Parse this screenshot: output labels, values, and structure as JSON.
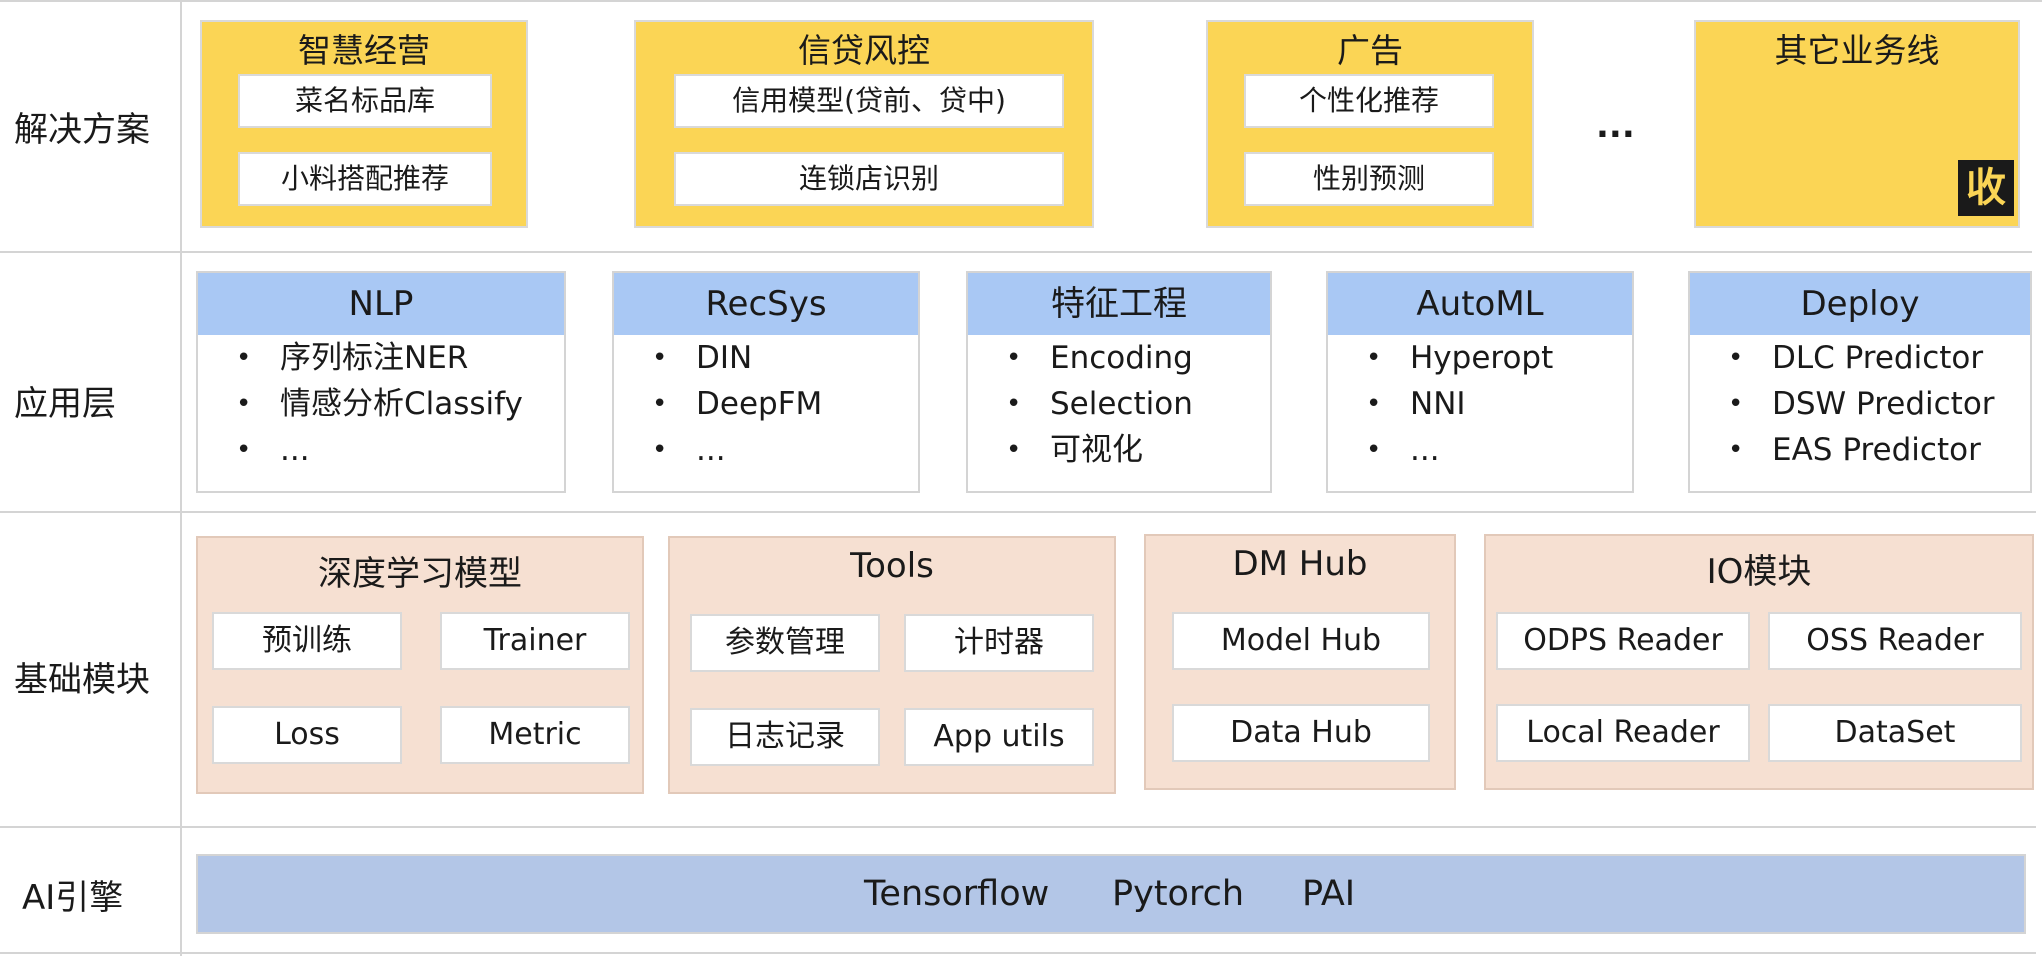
{
  "rows": {
    "solutions": "解决方案",
    "app_layer": "应用层",
    "base_modules": "基础模块",
    "ai_engine": "AI引擎"
  },
  "solutions": {
    "smart_ops": {
      "title": "智慧经营",
      "items": [
        "菜名标品库",
        "小料搭配推荐"
      ]
    },
    "credit_risk": {
      "title": "信贷风控",
      "items": [
        "信用模型(贷前、贷中)",
        "连锁店识别"
      ]
    },
    "ads": {
      "title": "广告",
      "items": [
        "个性化推荐",
        "性别预测"
      ]
    },
    "ellipsis": "...",
    "other": {
      "title": "其它业务线",
      "badge": "收"
    }
  },
  "app_layer": {
    "nlp": {
      "title": "NLP",
      "items": [
        "序列标注NER",
        "情感分析Classify",
        "..."
      ]
    },
    "recsys": {
      "title": "RecSys",
      "items": [
        "DIN",
        "DeepFM",
        "..."
      ]
    },
    "feature_eng": {
      "title": "特征工程",
      "items": [
        "Encoding",
        "Selection",
        "可视化"
      ]
    },
    "automl": {
      "title": "AutoML",
      "items": [
        "Hyperopt",
        "NNI",
        "..."
      ]
    },
    "deploy": {
      "title": "Deploy",
      "items": [
        "DLC Predictor",
        "DSW Predictor",
        "EAS Predictor"
      ]
    }
  },
  "base_modules": {
    "dl_models": {
      "title": "深度学习模型",
      "items": [
        "预训练",
        "Trainer",
        "Loss",
        "Metric"
      ]
    },
    "tools": {
      "title": "Tools",
      "items": [
        "参数管理",
        "计时器",
        "日志记录",
        "App utils"
      ]
    },
    "dm_hub": {
      "title": "DM Hub",
      "items": [
        "Model Hub",
        "Data Hub"
      ]
    },
    "io": {
      "title": "IO模块",
      "items": [
        "ODPS Reader",
        "OSS Reader",
        "Local Reader",
        "DataSet"
      ]
    }
  },
  "engine": {
    "items": [
      "Tensorflow",
      "Pytorch",
      "PAI"
    ]
  },
  "colors": {
    "solution_fill": "#fbd555",
    "app_header_fill": "#a9c8f4",
    "module_fill": "#f6e0d2",
    "engine_fill": "#b3c6e7"
  }
}
